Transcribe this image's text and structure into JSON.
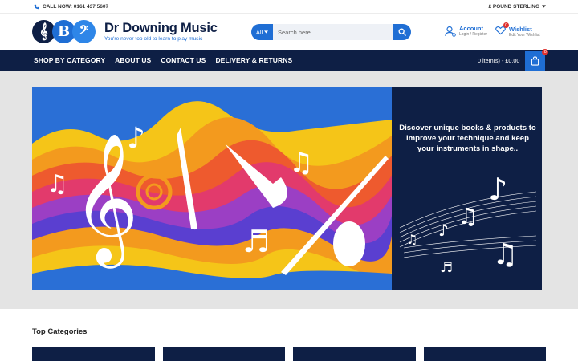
{
  "topbar": {
    "call_label": "CALL NOW: 0161 437 5607",
    "currency_label": "£ POUND STERLING",
    "phone_icon": "phone-icon",
    "caret_icon": "caret-down-icon"
  },
  "brand": {
    "name": "Dr Downing Music",
    "tagline": "You're never too old to learn to play music",
    "logo_glyphs": [
      "𝄞",
      "B",
      "𝄢"
    ]
  },
  "search": {
    "category": "All",
    "placeholder": "Search here...",
    "icon": "search-icon"
  },
  "account": {
    "title": "Account",
    "subtitle": "Login / Register",
    "icon": "user-icon"
  },
  "wishlist": {
    "title": "Wishlist",
    "subtitle": "Edit Your Wishlist",
    "count": "0",
    "icon": "heart-icon"
  },
  "nav": {
    "items": [
      {
        "label": "SHOP BY CATEGORY"
      },
      {
        "label": "ABOUT US"
      },
      {
        "label": "CONTACT US"
      },
      {
        "label": "DELIVERY & RETURNS"
      }
    ]
  },
  "cart": {
    "summary": "0 item(s) - £0.00",
    "count": "0",
    "icon": "shopping-bag-icon"
  },
  "banner": {
    "promo_text": "Discover unique books & products to improve your technique and keep your instruments in shape.."
  },
  "categories": {
    "title": "Top Categories",
    "cards": [
      "",
      "",
      "",
      ""
    ]
  },
  "colors": {
    "navy": "#0e1f45",
    "blue": "#1f6ed4",
    "badge_red": "#e0322f",
    "banner_bg": "#e4e4e4"
  }
}
